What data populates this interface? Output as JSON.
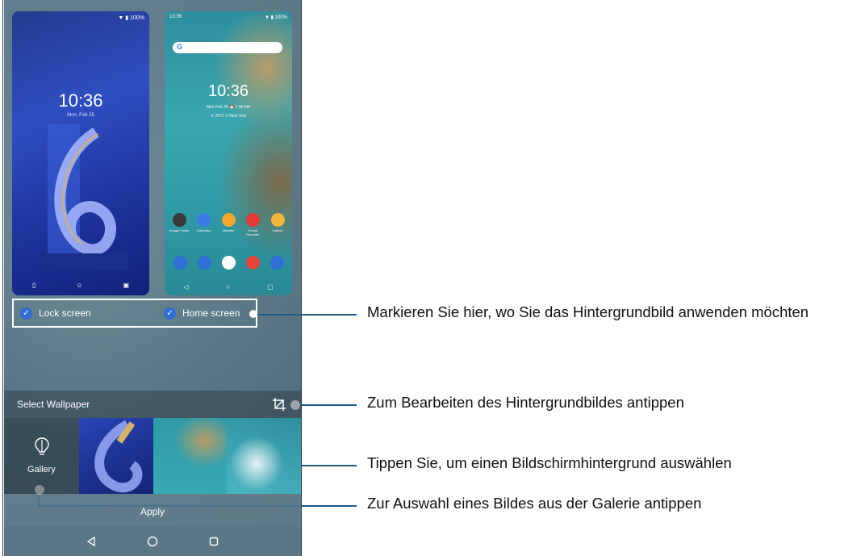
{
  "lock_preview": {
    "status": "▼ ▮ 100%",
    "time": "10:36",
    "date": "Mon, Feb 25"
  },
  "home_preview": {
    "status_left": "10:36",
    "status_right": "▼ ▮ 100%",
    "search_logo": "G",
    "time": "10:36",
    "date": "Mon Feb 25  ⏰ 7:30 AM",
    "weather": "☀ 26°C  ⚲ New York",
    "apps": [
      {
        "label": "Google Folder",
        "color": "#3a3a3a"
      },
      {
        "label": "Calculator",
        "color": "#3d7be6"
      },
      {
        "label": "Weather",
        "color": "#f4a52a"
      },
      {
        "label": "Sound Recorder",
        "color": "#e53935"
      },
      {
        "label": "Gallery",
        "color": "#f2b63c"
      }
    ],
    "dock": [
      {
        "name": "phone-icon",
        "color": "#2f6fd6"
      },
      {
        "name": "messages-icon",
        "color": "#2f6fd6"
      },
      {
        "name": "play-store-icon",
        "color": "#ffffff"
      },
      {
        "name": "chrome-icon",
        "color": "#e8453c"
      },
      {
        "name": "camera-icon",
        "color": "#2f6fd6"
      }
    ]
  },
  "targets": {
    "lock": "Lock screen",
    "home": "Home screen"
  },
  "select_wallpaper": {
    "title": "Select Wallpaper"
  },
  "gallery": {
    "label": "Gallery"
  },
  "apply": {
    "label": "Apply"
  },
  "callouts": {
    "c1": "Markieren Sie hier, wo Sie das Hintergrundbild anwenden möchten",
    "c2": "Zum Bearbeiten des Hintergrundbildes antippen",
    "c3": "Tippen Sie, um einen Bildschirmhintergrund auswählen",
    "c4": "Zur Auswahl eines Bildes aus der Galerie antippen"
  },
  "colors": {
    "accent": "#2f6fd6",
    "callout_line": "#1f5a86"
  }
}
